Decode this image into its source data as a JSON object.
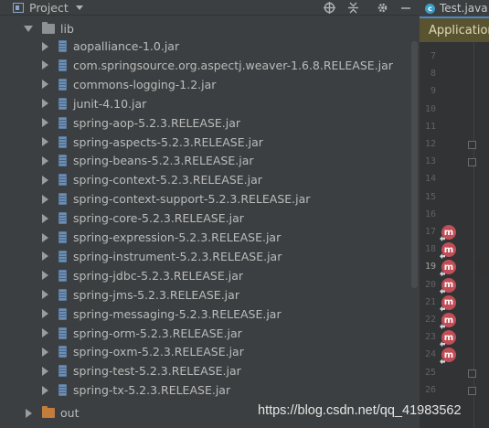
{
  "project_panel": {
    "title": "Project",
    "header_icons": [
      "crosshair-icon",
      "collapse-icon",
      "gear-icon",
      "hide-icon"
    ],
    "tree": {
      "lib_label": "lib",
      "jars": [
        "aopalliance-1.0.jar",
        "com.springsource.org.aspectj.weaver-1.6.8.RELEASE.jar",
        "commons-logging-1.2.jar",
        "junit-4.10.jar",
        "spring-aop-5.2.3.RELEASE.jar",
        "spring-aspects-5.2.3.RELEASE.jar",
        "spring-beans-5.2.3.RELEASE.jar",
        "spring-context-5.2.3.RELEASE.jar",
        "spring-context-support-5.2.3.RELEASE.jar",
        "spring-core-5.2.3.RELEASE.jar",
        "spring-expression-5.2.3.RELEASE.jar",
        "spring-instrument-5.2.3.RELEASE.jar",
        "spring-jdbc-5.2.3.RELEASE.jar",
        "spring-jms-5.2.3.RELEASE.jar",
        "spring-messaging-5.2.3.RELEASE.jar",
        "spring-orm-5.2.3.RELEASE.jar",
        "spring-oxm-5.2.3.RELEASE.jar",
        "spring-test-5.2.3.RELEASE.jar",
        "spring-tx-5.2.3.RELEASE.jar"
      ],
      "out_label": "out"
    }
  },
  "editor": {
    "tab_label": "Test.java",
    "breadcrumb": "Application",
    "line_numbers": [
      "7",
      "8",
      "9",
      "10",
      "11",
      "12",
      "13",
      "14",
      "15",
      "16",
      "17",
      "18",
      "19",
      "20",
      "21",
      "22",
      "23",
      "24",
      "25",
      "26"
    ],
    "active_line": "19"
  },
  "watermark": "https://blog.csdn.net/qq_41983562",
  "colors": {
    "panel_bg": "#3c3f41",
    "editor_bg": "#2b2b2b",
    "breadcrumb_bg": "#5a5330",
    "method_marker": "#c14d57"
  }
}
